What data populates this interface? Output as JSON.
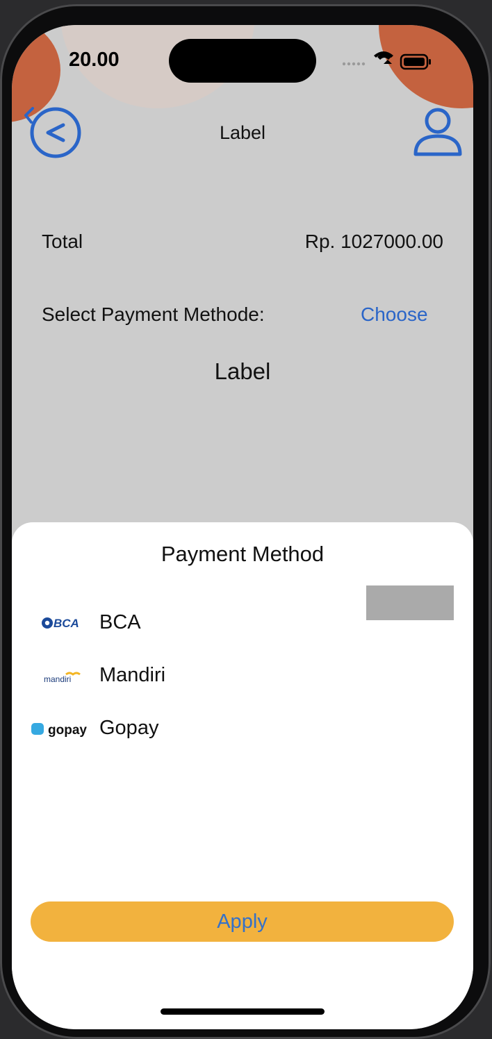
{
  "status_bar": {
    "time": "20.00"
  },
  "nav": {
    "title": "Label"
  },
  "summary": {
    "total_label": "Total",
    "total_value": "Rp. 1027000.00",
    "select_label": "Select Payment Methode:",
    "choose_label": "Choose",
    "center_label": "Label"
  },
  "sheet": {
    "title": "Payment Method",
    "methods": [
      {
        "label": "BCA",
        "logo_text": "BCA"
      },
      {
        "label": "Mandiri",
        "logo_text": "mandiri"
      },
      {
        "label": "Gopay",
        "logo_text": "gopay"
      }
    ],
    "apply_label": "Apply"
  },
  "colors": {
    "accent_blue": "#2a65c8",
    "apply_bg": "#f2b23e",
    "decor_orange": "#c4623f",
    "screen_bg": "#cccccc"
  }
}
